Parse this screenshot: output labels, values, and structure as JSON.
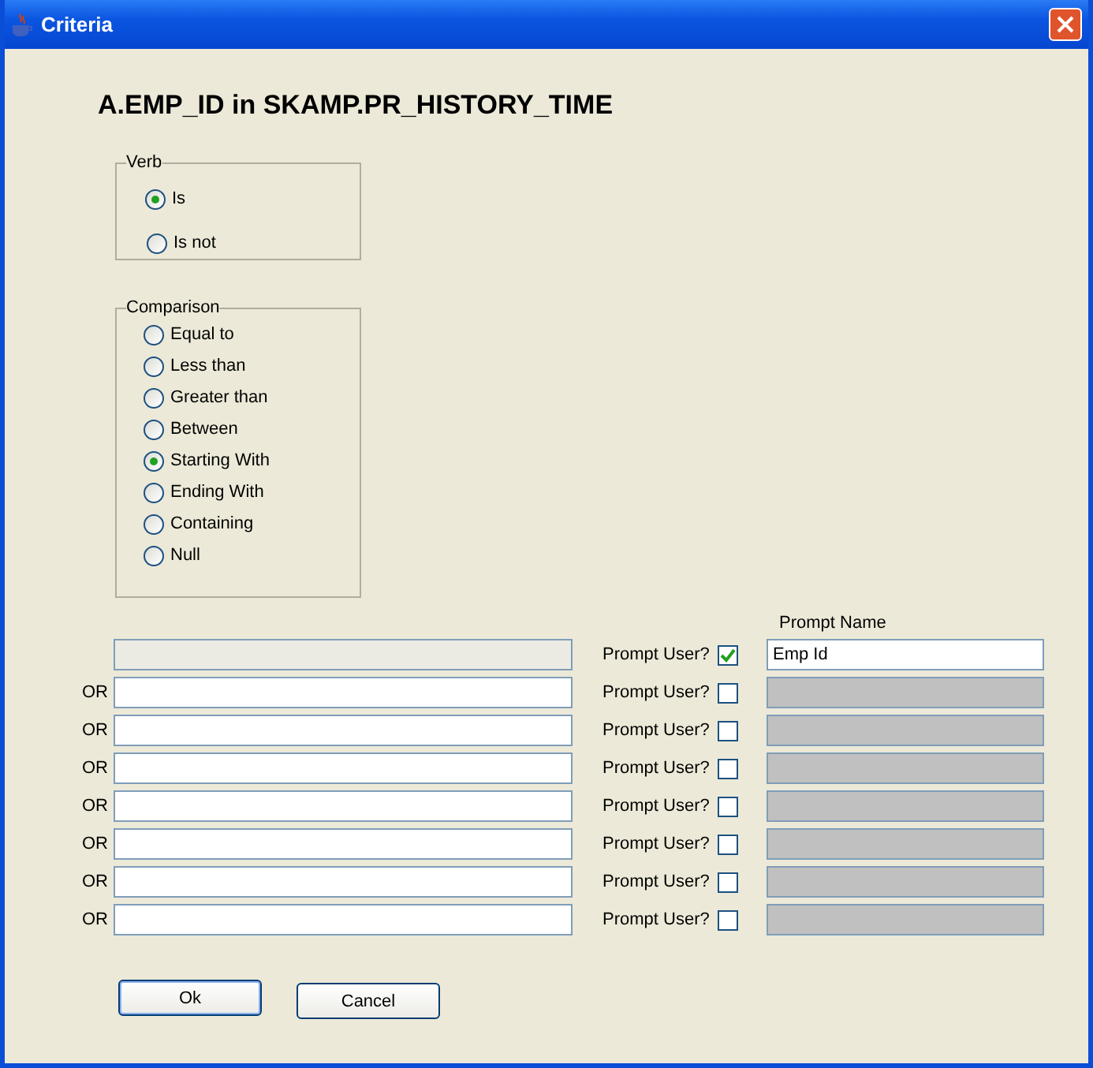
{
  "window": {
    "title": "Criteria"
  },
  "heading": "A.EMP_ID in SKAMP.PR_HISTORY_TIME",
  "verb": {
    "legend": "Verb",
    "options": [
      {
        "label": "Is",
        "selected": true
      },
      {
        "label": "Is not",
        "selected": false
      }
    ]
  },
  "comparison": {
    "legend": "Comparison",
    "options": [
      {
        "label": "Equal to",
        "selected": false
      },
      {
        "label": "Less than",
        "selected": false
      },
      {
        "label": "Greater than",
        "selected": false
      },
      {
        "label": "Between",
        "selected": false
      },
      {
        "label": "Starting With",
        "selected": true
      },
      {
        "label": "Ending With",
        "selected": false
      },
      {
        "label": "Containing",
        "selected": false
      },
      {
        "label": "Null",
        "selected": false
      }
    ]
  },
  "prompt_name_header": "Prompt Name",
  "rows": [
    {
      "value_disabled": true,
      "prompt_label": "Prompt User?",
      "checked": true,
      "prompt_name": "Emp Id"
    },
    {
      "or_label": "OR",
      "value_disabled": false,
      "prompt_label": "Prompt User?",
      "checked": false
    },
    {
      "or_label": "OR",
      "value_disabled": false,
      "prompt_label": "Prompt User?",
      "checked": false
    },
    {
      "or_label": "OR",
      "value_disabled": false,
      "prompt_label": "Prompt User?",
      "checked": false
    },
    {
      "or_label": "OR",
      "value_disabled": false,
      "prompt_label": "Prompt User?",
      "checked": false
    },
    {
      "or_label": "OR",
      "value_disabled": false,
      "prompt_label": "Prompt User?",
      "checked": false
    },
    {
      "or_label": "OR",
      "value_disabled": false,
      "prompt_label": "Prompt User?",
      "checked": false
    },
    {
      "or_label": "OR",
      "value_disabled": false,
      "prompt_label": "Prompt User?",
      "checked": false
    }
  ],
  "buttons": [
    "Ok",
    "Cancel"
  ]
}
